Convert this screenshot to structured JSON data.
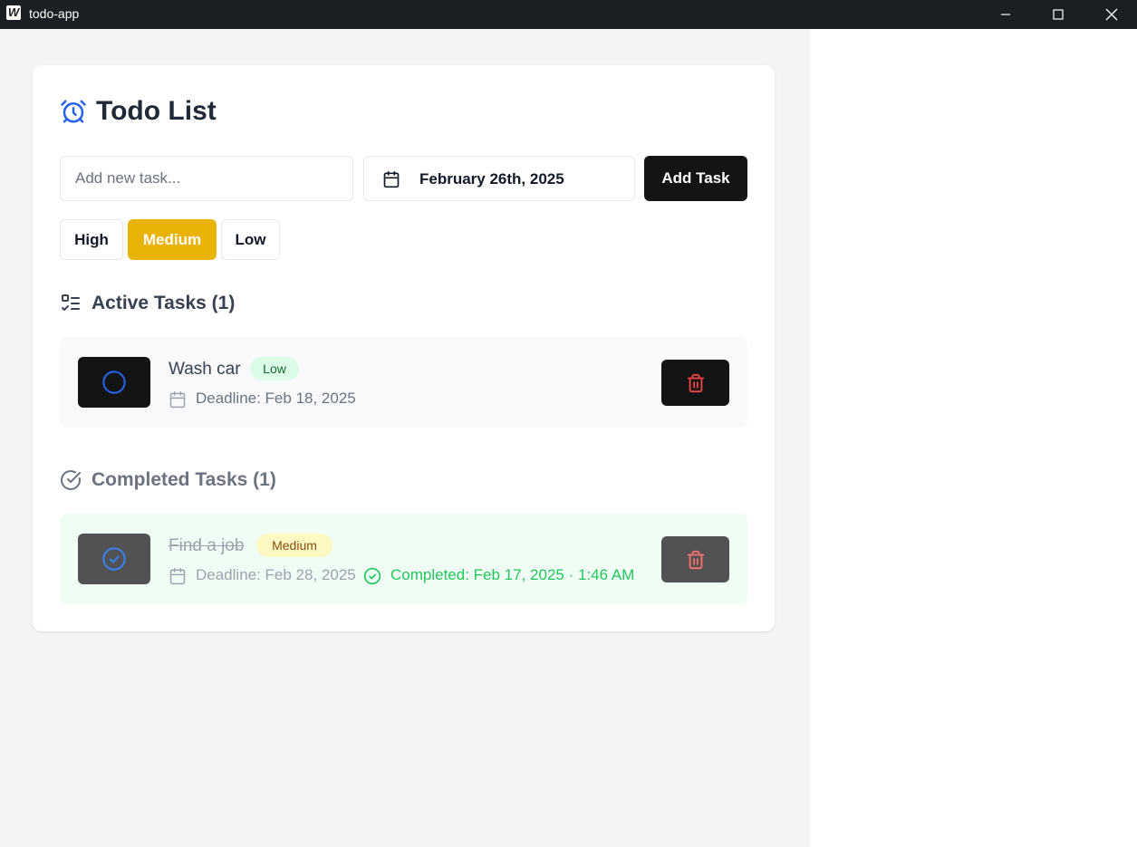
{
  "window": {
    "title": "todo-app"
  },
  "app": {
    "title": "Todo List",
    "new_task_placeholder": "Add new task...",
    "selected_date": "February 26th, 2025",
    "add_button": "Add Task",
    "priorities": [
      "High",
      "Medium",
      "Low"
    ],
    "selected_priority": "Medium"
  },
  "active": {
    "heading": "Active Tasks (1)",
    "tasks": [
      {
        "name": "Wash car",
        "priority": "Low",
        "deadline": "Deadline: Feb 18, 2025"
      }
    ]
  },
  "completed": {
    "heading": "Completed Tasks (1)",
    "tasks": [
      {
        "name": "Find a job",
        "priority": "Medium",
        "deadline": "Deadline: Feb 28, 2025",
        "completed_at": "Completed: Feb 17, 2025 · 1:46 AM"
      }
    ]
  },
  "icons": {
    "app_logo": "app-logo-icon",
    "heading": "alarm-clock-icon",
    "date": "calendar-icon",
    "active_section": "list-checks-icon",
    "completed_section": "circle-check-icon",
    "incomplete_toggle": "circle-icon",
    "complete_toggle": "circle-check-icon",
    "delete": "trash-icon"
  },
  "colors": {
    "accent": "#2563eb",
    "selected_priority": "#eab308",
    "danger": "#ef4444",
    "success": "#22c55e",
    "dark_button": "#141414"
  }
}
